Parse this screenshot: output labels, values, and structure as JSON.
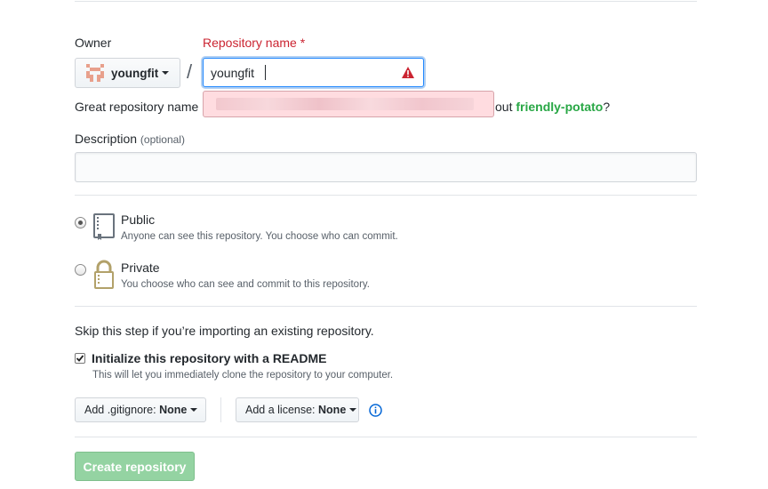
{
  "owner": {
    "label": "Owner",
    "name": "youngfit",
    "avatar_icon": "identicon-avatar"
  },
  "separator": "/",
  "repo": {
    "label": "Repository name",
    "required_mark": "*",
    "value": "youngfit",
    "error_icon": "warning-icon",
    "error_color": "#cb2431"
  },
  "suggestion": {
    "prefix": "Great repository name",
    "suffix_pre": "out",
    "name": "friendly-potato",
    "suffix_post": "?"
  },
  "description": {
    "label": "Description",
    "optional": "(optional)",
    "value": ""
  },
  "visibility": {
    "public": {
      "title": "Public",
      "desc": "Anyone can see this repository. You choose who can commit.",
      "icon": "repo-book-icon",
      "selected": true
    },
    "private": {
      "title": "Private",
      "desc": "You choose who can see and commit to this repository.",
      "icon": "lock-icon",
      "selected": false
    }
  },
  "import_note": "Skip this step if you’re importing an existing repository.",
  "readme": {
    "label": "Initialize this repository with a README",
    "desc": "This will let you immediately clone the repository to your computer.",
    "checked": true
  },
  "gitignore": {
    "label": "Add .gitignore:",
    "value": "None"
  },
  "license": {
    "label": "Add a license:",
    "value": "None",
    "info_icon": "info-icon"
  },
  "submit": {
    "label": "Create repository",
    "color": "#94d3a2"
  }
}
